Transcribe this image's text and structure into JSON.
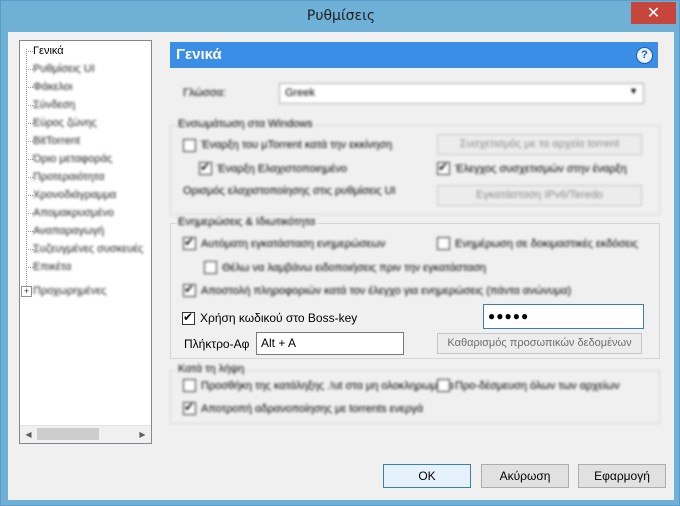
{
  "window": {
    "title": "Ρυθμίσεις",
    "close_icon": "close-icon"
  },
  "sidebar": {
    "items": [
      {
        "label": "Γενικά"
      },
      {
        "label": "Ρυθμίσεις UI"
      },
      {
        "label": "Φάκελοι"
      },
      {
        "label": "Σύνδεση"
      },
      {
        "label": "Εύρος ζώνης"
      },
      {
        "label": "BitTorrent"
      },
      {
        "label": "Όριο μεταφοράς"
      },
      {
        "label": "Προτεραιότητα"
      },
      {
        "label": "Χρονοδιάγραμμα"
      },
      {
        "label": "Απομακρυσμένο"
      },
      {
        "label": "Αναπαραγωγή"
      },
      {
        "label": "Συζευγμένες συσκευές"
      },
      {
        "label": "Επικέτα"
      },
      {
        "label": "Προχωρημένες"
      }
    ]
  },
  "header": {
    "title": "Γενικά",
    "help_icon": "help-icon"
  },
  "language": {
    "label": "Γλώσσα:",
    "value": "Greek"
  },
  "windows_integration": {
    "title": "Ενσωμάτωση στα Windows",
    "start_with_windows": "Έναρξη του μTorrent κατά την εκκίνηση",
    "start_minimized": "Έναρξη Ελαχιστοποιημένο",
    "associate_button": "Συσχετισμός με τα αρχεία torrent",
    "check_association": "Έλεγχος συσχετισμών στην έναρξη",
    "minimize_label": "Ορισμός ελαχιστοποίησης στις ρυθμίσεις UI",
    "ipv6_button": "Εγκατάσταση IPv6/Teredo"
  },
  "updates_privacy": {
    "title": "Ενημερώσεις & Ιδιωτικότητα",
    "auto_install": "Αυτόματη εγκατάσταση ενημερώσεων",
    "beta_updates": "Ενημέρωση σε δοκιμαστικές εκδόσεις",
    "notify_before": "Θέλω να λαμβάνω ειδοποιήσεις πριν την εγκατάσταση",
    "send_info": "Αποστολή πληροφοριών κατά τον έλεγχο για ενημερώσεις (πάντα ανώνυμα)",
    "boss_key_password_label": "Χρήση κωδικού στο Boss-key",
    "boss_key_password_value": "●●●●●",
    "hotkey_label": "Πλήκτρο-Αφ",
    "hotkey_value": "Alt + A",
    "clear_private_button": "Καθαρισμός προσωπικών δεδομένων"
  },
  "on_download": {
    "title": "Κατά τη λήψη",
    "append_ut": "Προσθήκη της κατάληξης .!ut στα μη ολοκληρωμένα",
    "prealloc": "Προ-δέσμευση όλων των αρχείων",
    "prevent_standby": "Αποτροπή αδρανοποίησης με torrents ενεργά"
  },
  "footer": {
    "ok": "OK",
    "cancel": "Ακύρωση",
    "apply": "Εφαρμογή"
  }
}
